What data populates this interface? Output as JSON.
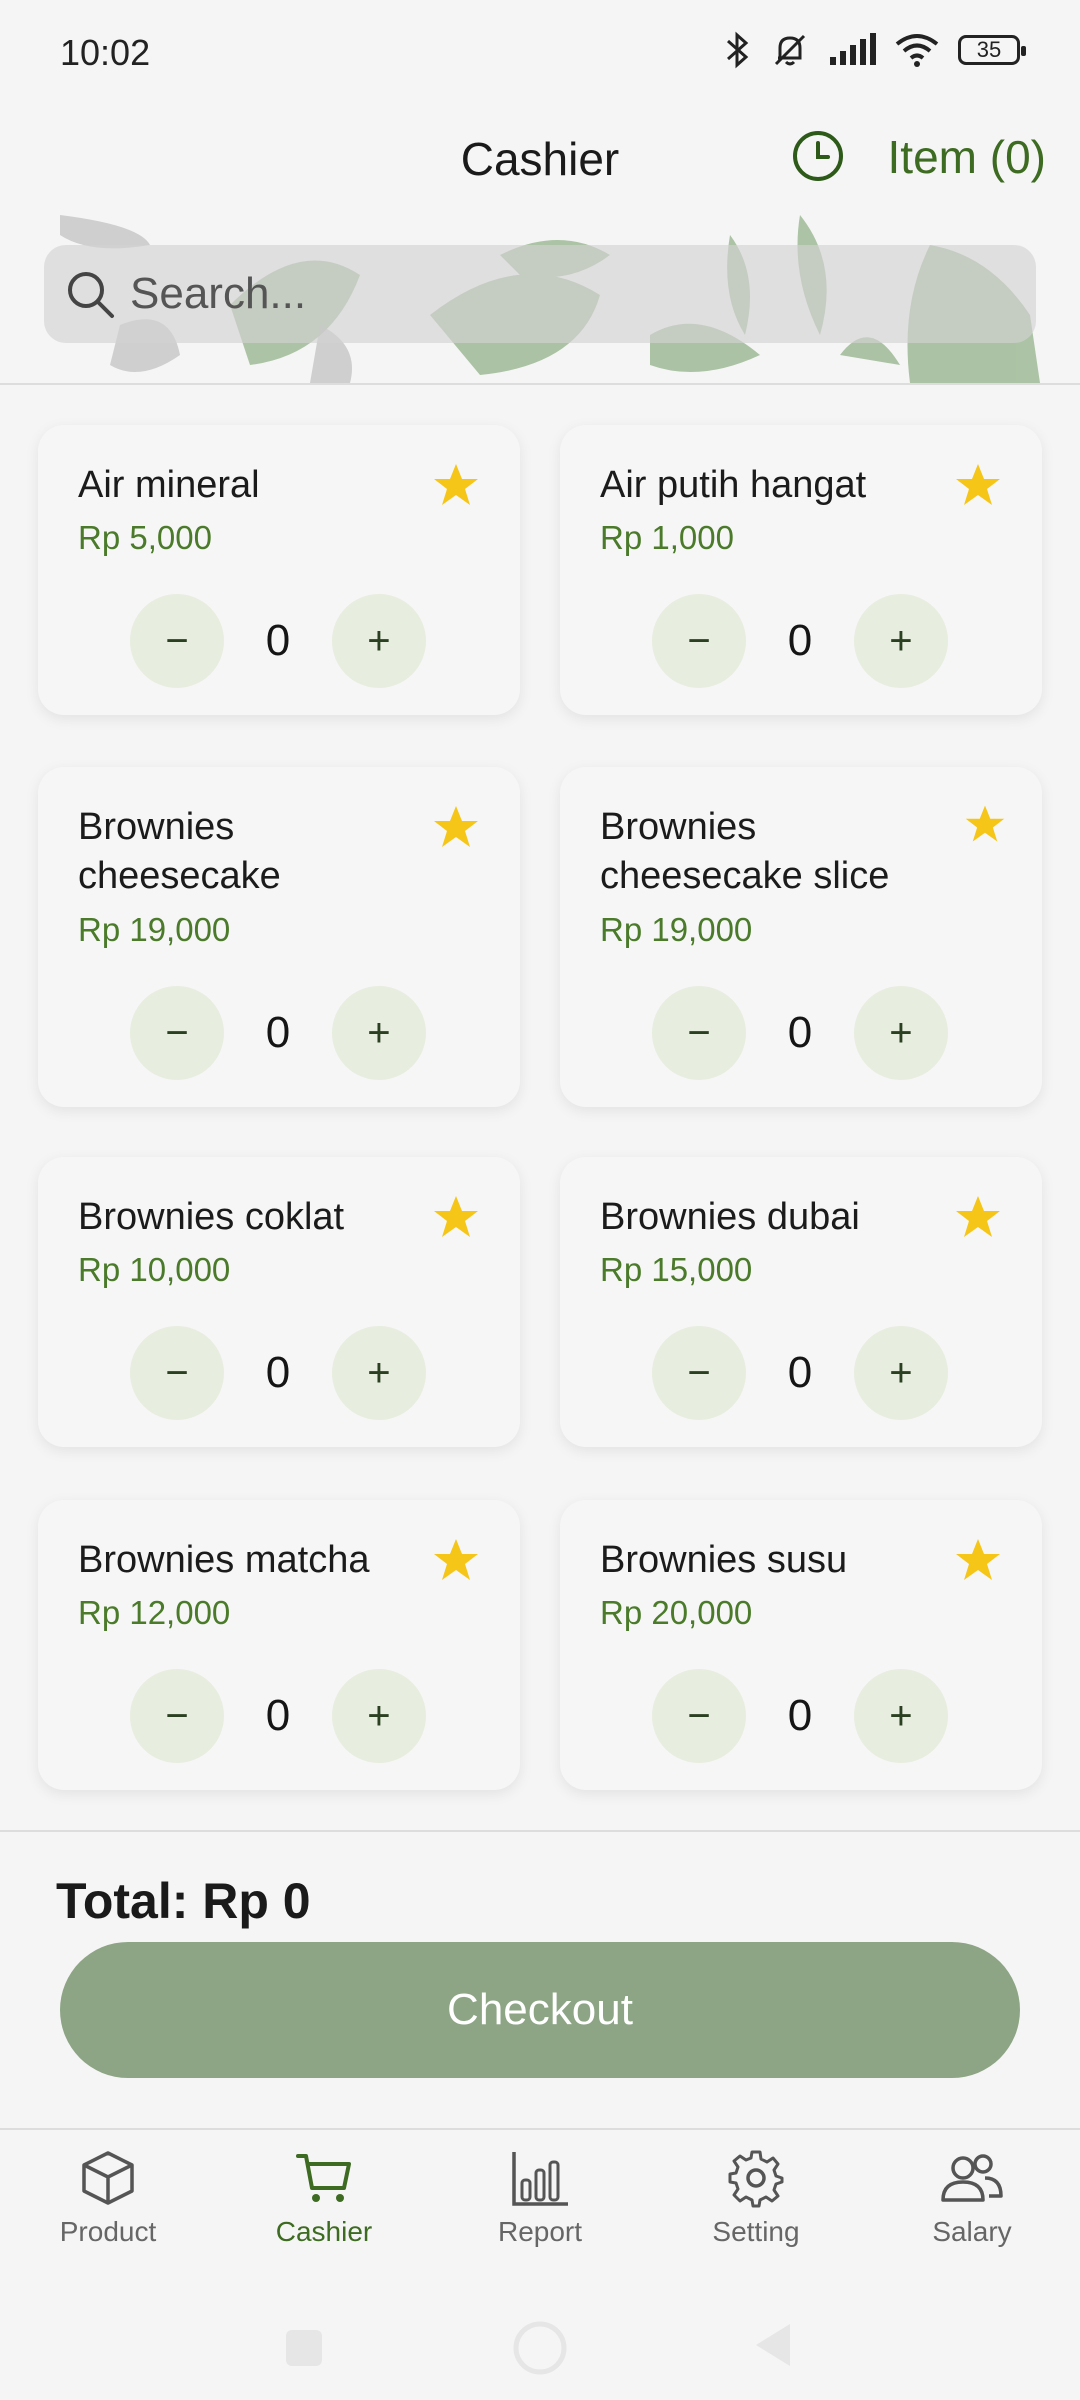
{
  "status_bar": {
    "time": "10:02",
    "battery": "35"
  },
  "header": {
    "title": "Cashier",
    "item_count": "Item (0)"
  },
  "search": {
    "placeholder": "Search..."
  },
  "products": [
    {
      "name": "Air mineral",
      "price": "Rp 5,000",
      "qty": "0"
    },
    {
      "name": "Air putih hangat",
      "price": "Rp 1,000",
      "qty": "0"
    },
    {
      "name": "Brownies cheesecake",
      "price": "Rp 19,000",
      "qty": "0"
    },
    {
      "name": "Brownies cheesecake slice",
      "price": "Rp 19,000",
      "qty": "0"
    },
    {
      "name": "Brownies coklat",
      "price": "Rp 10,000",
      "qty": "0"
    },
    {
      "name": "Brownies dubai",
      "price": "Rp 15,000",
      "qty": "0"
    },
    {
      "name": "Brownies matcha",
      "price": "Rp 12,000",
      "qty": "0"
    },
    {
      "name": "Brownies susu",
      "price": "Rp 20,000",
      "qty": "0"
    }
  ],
  "qty_controls": {
    "minus": "−",
    "plus": "+"
  },
  "summary": {
    "total": "Total: Rp 0",
    "checkout_label": "Checkout"
  },
  "bottom_nav": [
    {
      "label": "Product",
      "icon": "box-icon"
    },
    {
      "label": "Cashier",
      "icon": "cart-icon",
      "active": true
    },
    {
      "label": "Report",
      "icon": "bar-chart-icon"
    },
    {
      "label": "Setting",
      "icon": "gear-icon"
    },
    {
      "label": "Salary",
      "icon": "people-icon"
    }
  ],
  "colors": {
    "accent": "#3e6b22",
    "checkout": "#8da585",
    "star": "#f5c518",
    "qty_button": "#e7eddf"
  }
}
